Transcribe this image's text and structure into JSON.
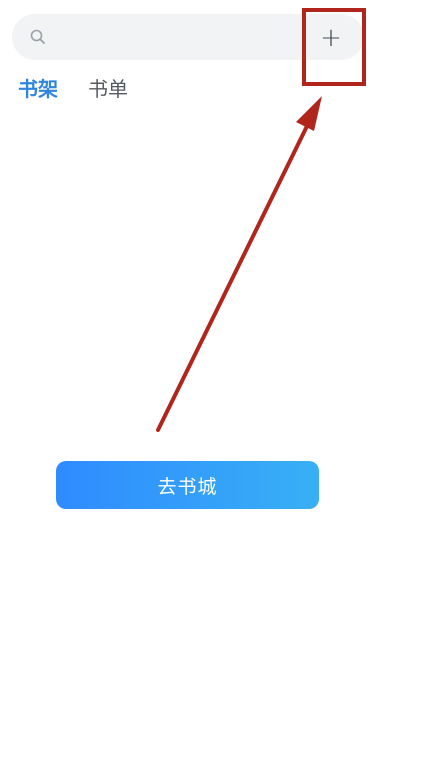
{
  "search": {
    "icon": "search-icon",
    "placeholder": ""
  },
  "toolbar": {
    "add_label": "+",
    "add_icon": "plus-icon"
  },
  "tabs": [
    {
      "label": "书架",
      "active": true
    },
    {
      "label": "书单",
      "active": false
    }
  ],
  "empty_state": {
    "button_label": "去书城"
  },
  "colors": {
    "accent": "#2f86de",
    "button_start": "#2f8bff",
    "button_end": "#38b0f5",
    "annotation": "#b1261c"
  }
}
